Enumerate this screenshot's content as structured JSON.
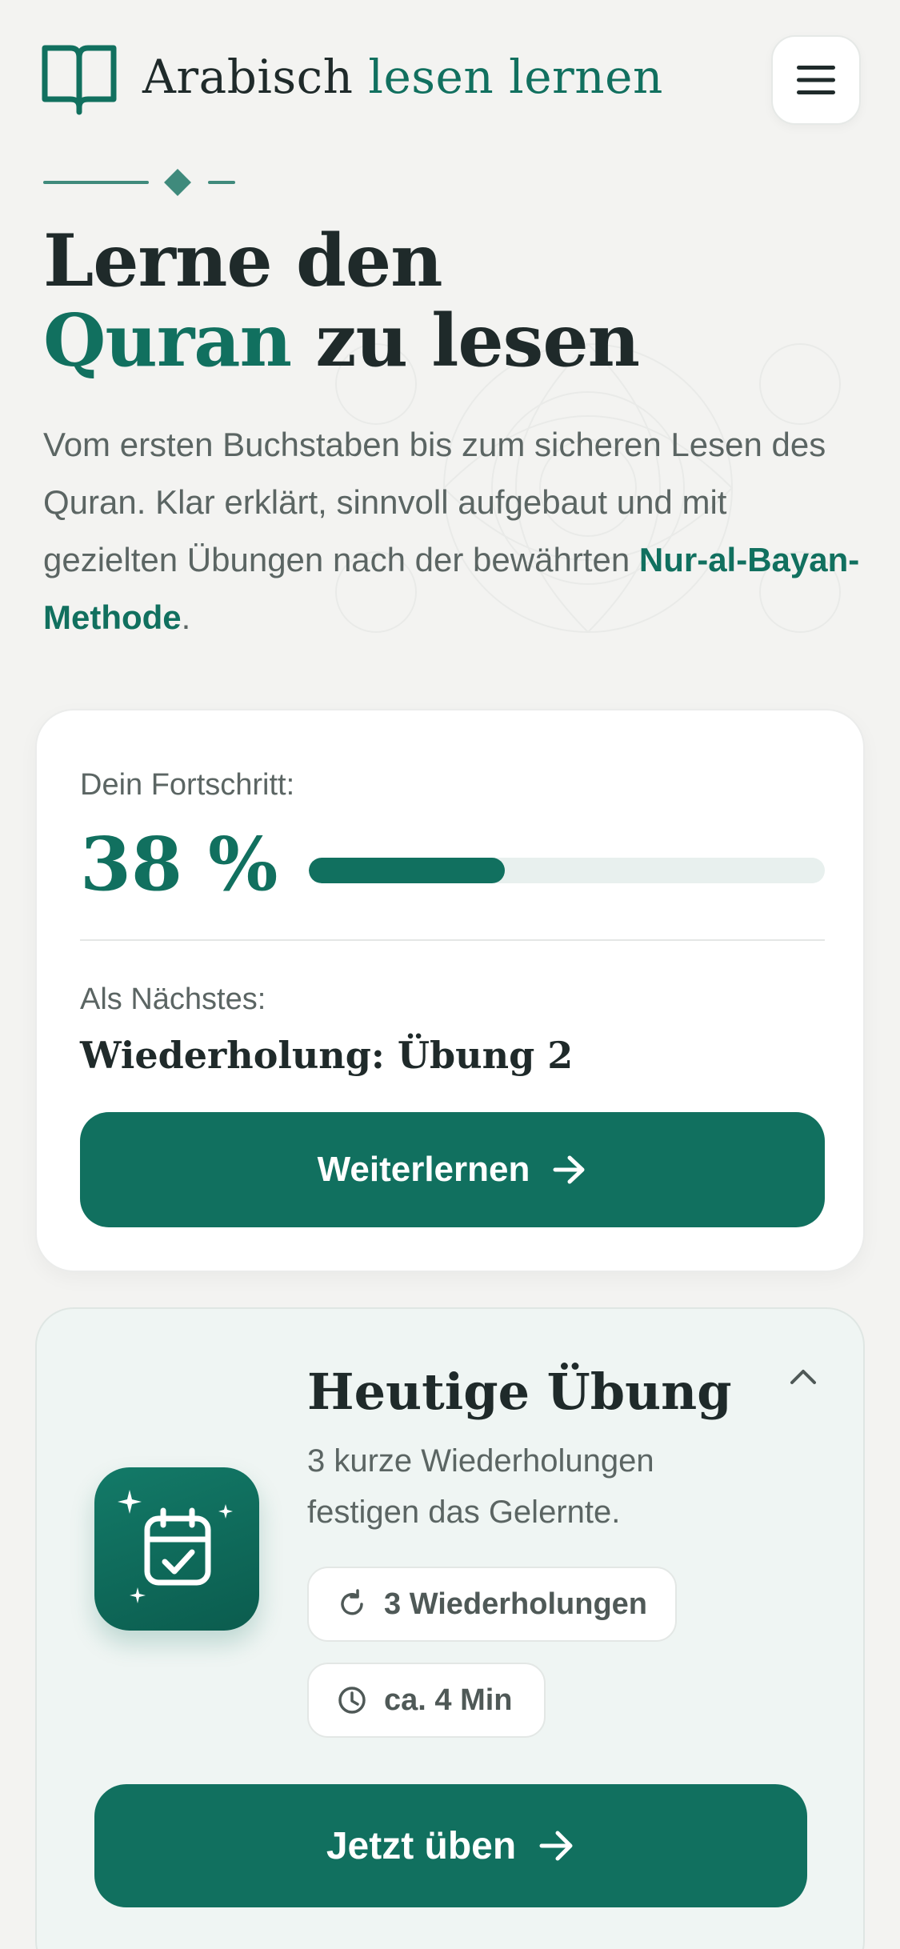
{
  "header": {
    "brand_part1": "Arabisch",
    "brand_part2": "lesen lernen",
    "logo_icon": "open-book-icon",
    "menu_icon": "hamburger-menu-icon"
  },
  "hero": {
    "title_line1": "Lerne den",
    "title_highlight": "Quran",
    "title_rest": "zu lesen",
    "description": "Vom ersten Buchstaben bis zum sicheren Lesen des Quran. Klar erklärt, sinnvoll aufgebaut und mit gezielten Übungen nach der bewährten",
    "method_link": "Nur-al-Bayan-Methode",
    "description_end": "."
  },
  "progress": {
    "label": "Dein Fortschritt:",
    "value_text": "38 %",
    "fraction": 0.38,
    "next_label": "Als Nächstes:",
    "next_title": "Wiederholung: Übung 2",
    "button_label": "Weiterlernen",
    "button_icon": "arrow-right-icon"
  },
  "exercise": {
    "title": "Heutige Übung",
    "description": "3 kurze Wiederholungen festigen das Gelernte.",
    "tile_icon": "calendar-check-icon",
    "collapse_icon": "chevron-up-icon",
    "chip_repetitions": "3 Wiederholungen",
    "chip_repetitions_icon": "refresh-icon",
    "chip_duration": "ca. 4 Min",
    "chip_duration_icon": "clock-icon",
    "button_label": "Jetzt üben",
    "button_icon": "arrow-right-icon"
  },
  "colors": {
    "accent": "#11705f",
    "background": "#f3f3f1",
    "text": "#1f2a2a",
    "muted_text": "#5b6563"
  }
}
